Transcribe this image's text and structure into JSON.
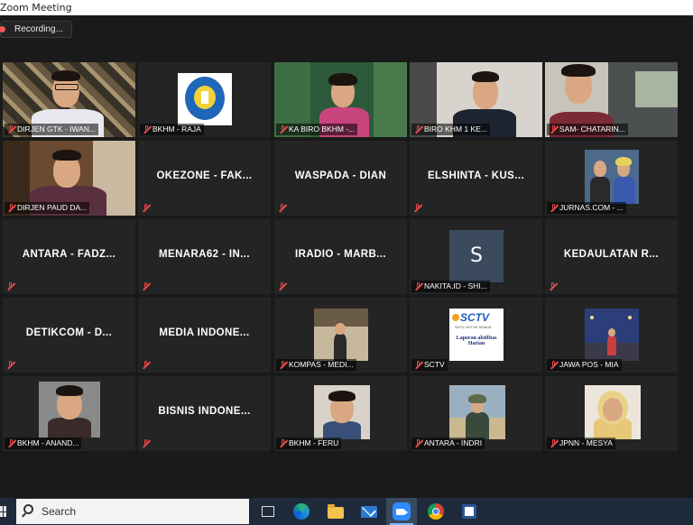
{
  "window": {
    "title": "Zoom Meeting"
  },
  "recording": {
    "label": "Recording..."
  },
  "tiles": [
    {
      "id": "t1",
      "label": "DIRJEN GTK - IWAN...",
      "name_display": "",
      "type": "video",
      "active": true
    },
    {
      "id": "t2",
      "label": "BKHM - RAJA",
      "name_display": "",
      "type": "logo"
    },
    {
      "id": "t3",
      "label": "KA BIRO BKHM -...",
      "name_display": "",
      "type": "video"
    },
    {
      "id": "t4",
      "label": "BIRO KHM 1 KE...",
      "name_display": "",
      "type": "video"
    },
    {
      "id": "t5",
      "label": "SAM- CHATARIN...",
      "name_display": "",
      "type": "video"
    },
    {
      "id": "t6",
      "label": "DIRJEN PAUD DA...",
      "name_display": "",
      "type": "video"
    },
    {
      "id": "t7",
      "label": "",
      "name_display": "OKEZONE - FAK...",
      "type": "name"
    },
    {
      "id": "t8",
      "label": "",
      "name_display": "WASPADA - DIAN",
      "type": "name"
    },
    {
      "id": "t9",
      "label": "",
      "name_display": "ELSHINTA - KUS...",
      "type": "name"
    },
    {
      "id": "t10",
      "label": "JURNAS.COM - ...",
      "name_display": "",
      "type": "photo"
    },
    {
      "id": "t11",
      "label": "",
      "name_display": "ANTARA - FADZ...",
      "type": "name"
    },
    {
      "id": "t12",
      "label": "",
      "name_display": "MENARA62 - IN...",
      "type": "name"
    },
    {
      "id": "t13",
      "label": "",
      "name_display": "IRADIO - MARB...",
      "type": "name"
    },
    {
      "id": "t14",
      "label": "NAKITA.ID - SHI...",
      "name_display": "S",
      "type": "initial"
    },
    {
      "id": "t15",
      "label": "",
      "name_display": "KEDAULATAN R...",
      "type": "name"
    },
    {
      "id": "t16",
      "label": "",
      "name_display": "DETIKCOM - D...",
      "type": "name"
    },
    {
      "id": "t17",
      "label": "",
      "name_display": "MEDIA INDONE...",
      "type": "name"
    },
    {
      "id": "t18",
      "label": "KOMPAS - MEDI...",
      "name_display": "",
      "type": "photo"
    },
    {
      "id": "t19",
      "label": "SCTV",
      "name_display": "",
      "type": "sctv"
    },
    {
      "id": "t20",
      "label": "JAWA POS - MIA",
      "name_display": "",
      "type": "photo"
    },
    {
      "id": "t21",
      "label": "BKHM - ANAND...",
      "name_display": "",
      "type": "photo"
    },
    {
      "id": "t22",
      "label": "",
      "name_display": "BISNIS INDONE...",
      "type": "name"
    },
    {
      "id": "t23",
      "label": "BKHM - FERU",
      "name_display": "",
      "type": "photo"
    },
    {
      "id": "t24",
      "label": "ANTARA - INDRI",
      "name_display": "",
      "type": "photo"
    },
    {
      "id": "t25",
      "label": "JPNN - MESYA",
      "name_display": "",
      "type": "photo"
    }
  ],
  "sctv": {
    "brand": "SCTV",
    "tagline": "SATU UNTUK SEMUA",
    "caption": "Laporan aktifitas Harian"
  },
  "taskbar": {
    "search_placeholder": "Search"
  },
  "colors": {
    "active_speaker": "#b9e34a",
    "tile_bg": "#242424",
    "muted_mic": "#e54b4b",
    "taskbar": "#1f2b3a"
  }
}
